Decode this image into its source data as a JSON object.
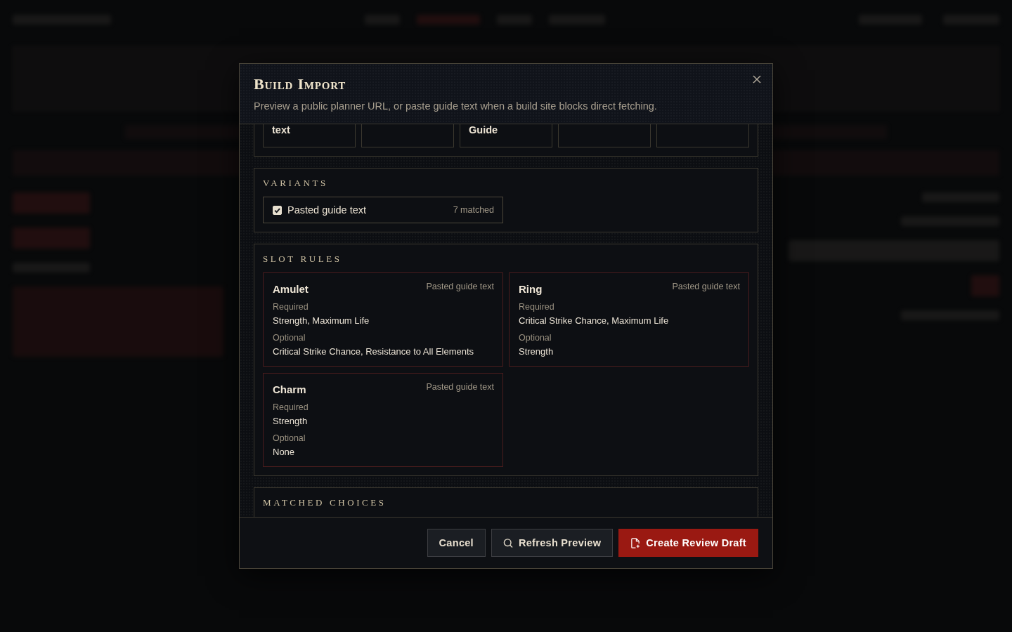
{
  "dialog": {
    "title": "Build Import",
    "subtitle": "Preview a public planner URL, or paste guide text when a build site blocks direct fetching."
  },
  "summary_cells": [
    {
      "kind": "text",
      "value": "text"
    },
    {
      "kind": "blank"
    },
    {
      "kind": "text",
      "value": "Guide"
    },
    {
      "kind": "blank"
    },
    {
      "kind": "blank"
    }
  ],
  "variants": {
    "heading": "VARIANTS",
    "items": [
      {
        "label": "Pasted guide text",
        "count": "7 matched",
        "checked": true
      }
    ]
  },
  "slot_rules": {
    "heading": "SLOT RULES",
    "rules": [
      {
        "slot": "Amulet",
        "source": "Pasted guide text",
        "required_label": "Required",
        "required": "Strength, Maximum Life",
        "optional_label": "Optional",
        "optional": "Critical Strike Chance, Resistance to All Elements"
      },
      {
        "slot": "Ring",
        "source": "Pasted guide text",
        "required_label": "Required",
        "required": "Critical Strike Chance, Maximum Life",
        "optional_label": "Optional",
        "optional": "Strength"
      },
      {
        "slot": "Charm",
        "source": "Pasted guide text",
        "required_label": "Required",
        "required": "Strength",
        "optional_label": "Optional",
        "optional": "None"
      }
    ]
  },
  "matched_choices": {
    "heading": "MATCHED CHOICES"
  },
  "footer": {
    "buttons": [
      {
        "kind": "plain",
        "label": "Cancel"
      },
      {
        "kind": "search",
        "label": "Refresh Preview"
      },
      {
        "kind": "primary",
        "label": "Create Review Draft"
      }
    ]
  }
}
